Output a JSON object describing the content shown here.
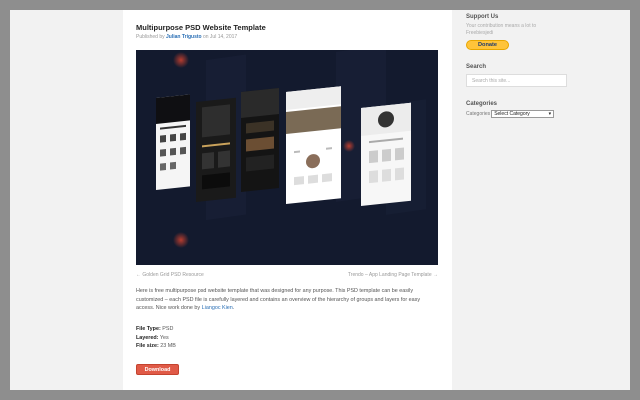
{
  "post": {
    "title": "Multipurpose PSD Website Template",
    "byline_prefix": "Published by ",
    "author": "Julian Trigusto",
    "byline_suffix": " on Jul 14, 2017",
    "prev_link": "← Golden Grid PSD Resource",
    "next_link": "Trendo – App Landing Page Template →",
    "description": "Here is free multipurpose psd website template that was designed for any purpose. This PSD template can be easily customized – each PSD file is carefully layered and contains an overview of the hierarchy of groups and layers for easy access. Nice work done by ",
    "credit": "Liangoc Kien",
    "description_end": ".",
    "file_type_label": "File Type:",
    "file_type": "PSD",
    "layered_label": "Layered:",
    "layered": "Yes",
    "file_size_label": "File size:",
    "file_size": "23 MB",
    "download_label": "Download"
  },
  "sidebar": {
    "support_title": "Support Us",
    "support_text": "Your contribution means a lot to Freebiesjedi",
    "donate_label": "Donate",
    "search_title": "Search",
    "search_placeholder": "Search this site...",
    "categories_title": "Categories",
    "categories_label": "Categories",
    "categories_selected": "Select Category"
  },
  "colors": {
    "accent": "#e05a47",
    "link": "#2a6fb5",
    "donate": "#ffc43a",
    "hero_bg": "#131a2e"
  }
}
